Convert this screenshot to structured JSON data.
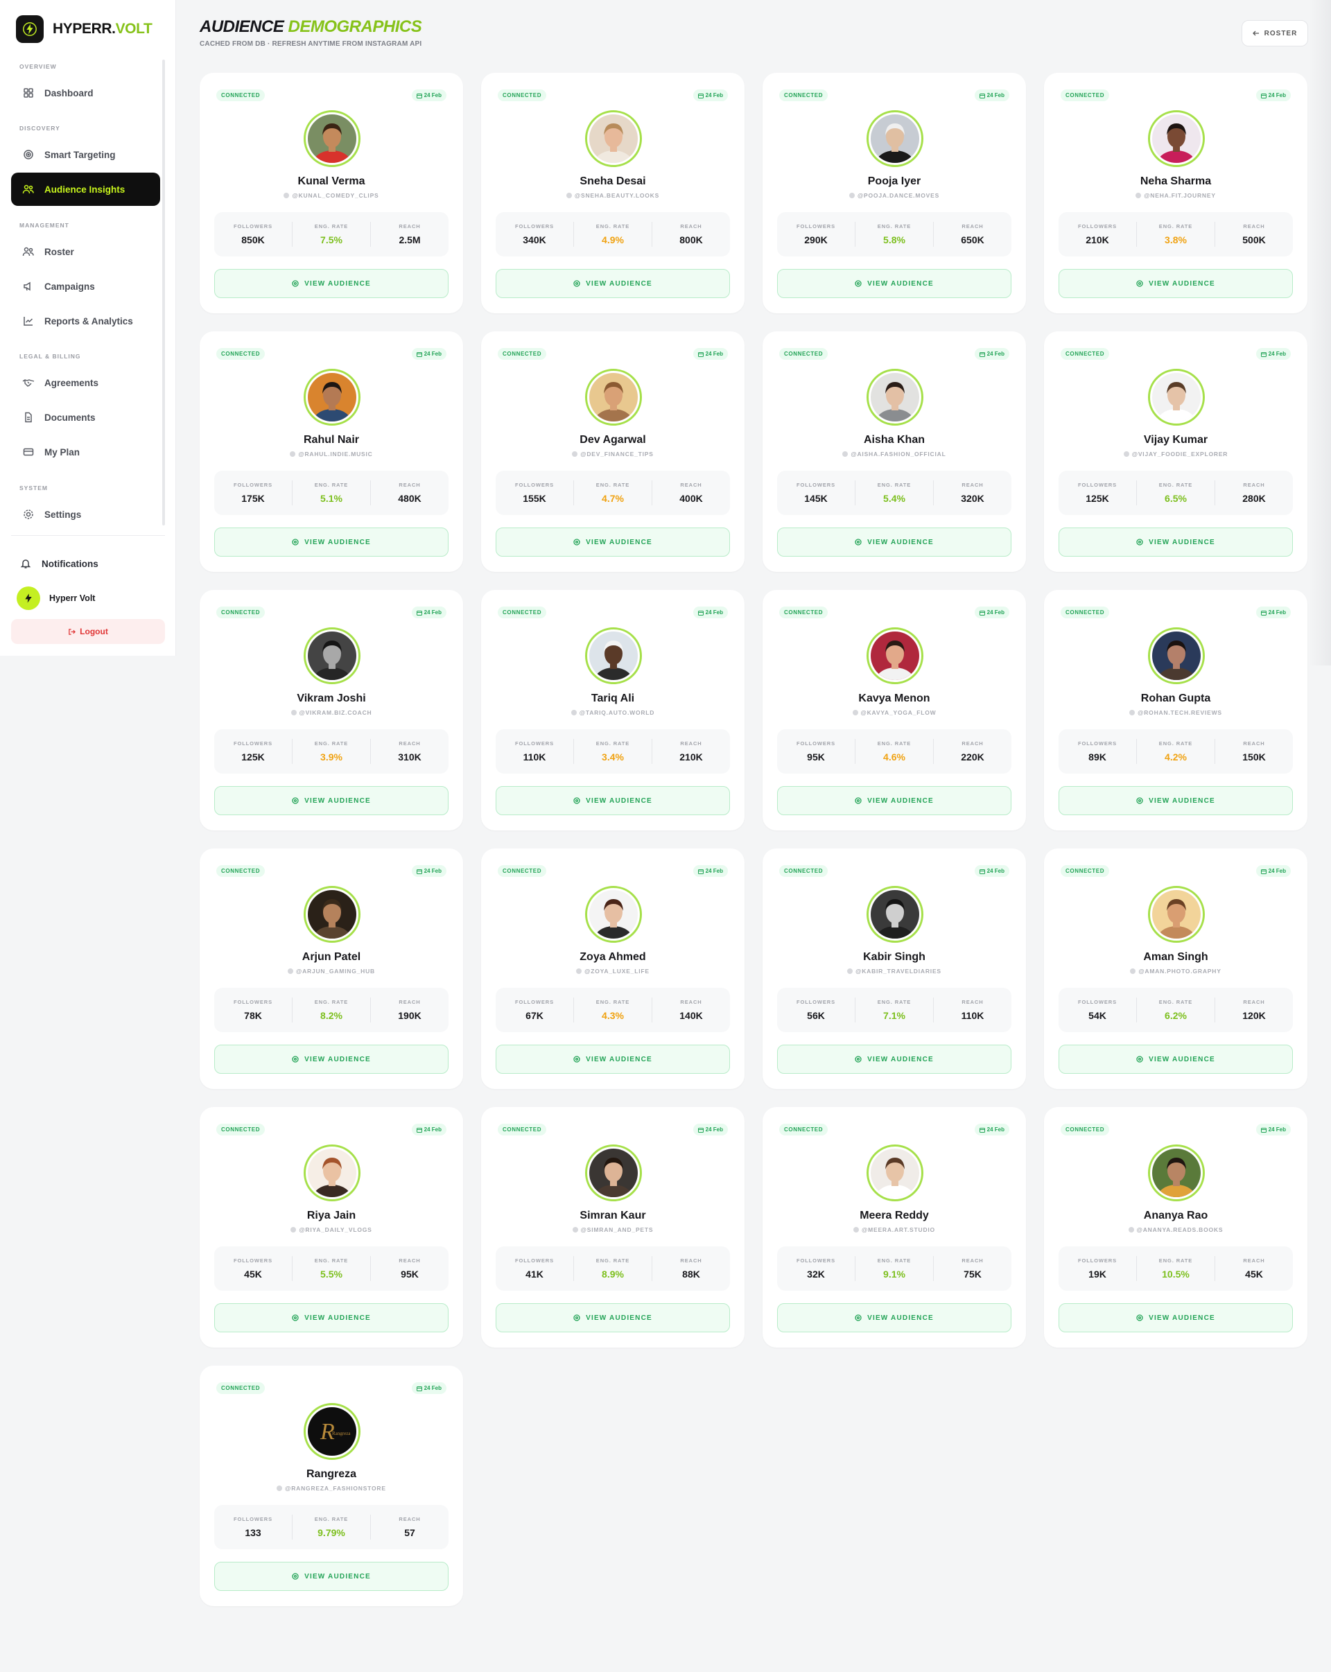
{
  "brand": {
    "name_part1": "HYPERR.",
    "name_part2": "VOLT"
  },
  "sidebar": {
    "sections": {
      "overview": "OVERVIEW",
      "discovery": "DISCOVERY",
      "management": "MANAGEMENT",
      "legal": "LEGAL & BILLING",
      "system": "SYSTEM"
    },
    "items": [
      {
        "label": "Dashboard",
        "icon": "grid-icon"
      },
      {
        "label": "Smart Targeting",
        "icon": "target-icon"
      },
      {
        "label": "Audience Insights",
        "icon": "users-icon",
        "active": true
      },
      {
        "label": "Roster",
        "icon": "user-group-icon"
      },
      {
        "label": "Campaigns",
        "icon": "megaphone-icon"
      },
      {
        "label": "Reports & Analytics",
        "icon": "chart-icon"
      },
      {
        "label": "Agreements",
        "icon": "handshake-icon"
      },
      {
        "label": "Documents",
        "icon": "document-icon"
      },
      {
        "label": "My Plan",
        "icon": "card-icon"
      },
      {
        "label": "Settings",
        "icon": "gear-icon"
      }
    ],
    "notifications": "Notifications",
    "user_name": "Hyperr Volt",
    "logout": "Logout"
  },
  "page": {
    "title_part1": "AUDIENCE",
    "title_part2": "DEMOGRAPHICS",
    "subtitle": "CACHED FROM DB · REFRESH ANYTIME FROM INSTAGRAM API",
    "roster_button": "ROSTER"
  },
  "labels": {
    "connected": "CONNECTED",
    "followers": "FOLLOWERS",
    "eng_rate": "ENG. RATE",
    "reach": "REACH",
    "view_audience": "VIEW AUDIENCE"
  },
  "colors": {
    "accent": "#86c21a",
    "connected_green": "#22a356",
    "eng_orange": "#f0a211",
    "eng_green": "#7cbf1d"
  },
  "influencers": [
    {
      "name": "Kunal Verma",
      "handle": "@KUNAL_COMEDY_CLIPS",
      "date": "24 Feb",
      "followers": "850K",
      "eng_rate": "7.5%",
      "eng_tone": "green",
      "reach": "2.5M",
      "av_bg": "#7a8e63",
      "av_skin": "#c48a5c",
      "av_hair": "#3a2413",
      "av_shirt": "#d8322c"
    },
    {
      "name": "Sneha Desai",
      "handle": "@SNEHA.BEAUTY.LOOKS",
      "date": "24 Feb",
      "followers": "340K",
      "eng_rate": "4.9%",
      "eng_tone": "orange",
      "reach": "800K",
      "av_bg": "#e6d8c8",
      "av_skin": "#e7b99a",
      "av_hair": "#b78b5a",
      "av_shirt": "#f0e9df"
    },
    {
      "name": "Pooja Iyer",
      "handle": "@POOJA.DANCE.MOVES",
      "date": "24 Feb",
      "followers": "290K",
      "eng_rate": "5.8%",
      "eng_tone": "green",
      "reach": "650K",
      "av_bg": "#c7ccd3",
      "av_skin": "#e0bfa2",
      "av_hair": "#efefef",
      "av_shirt": "#1a1a1a"
    },
    {
      "name": "Neha Sharma",
      "handle": "@NEHA.FIT.JOURNEY",
      "date": "24 Feb",
      "followers": "210K",
      "eng_rate": "3.8%",
      "eng_tone": "orange",
      "reach": "500K",
      "av_bg": "#efe7ee",
      "av_skin": "#7a4a34",
      "av_hair": "#1e1412",
      "av_shirt": "#c81e5a"
    },
    {
      "name": "Rahul Nair",
      "handle": "@RAHUL.INDIE.MUSIC",
      "date": "24 Feb",
      "followers": "175K",
      "eng_rate": "5.1%",
      "eng_tone": "green",
      "reach": "480K",
      "av_bg": "#d9842e",
      "av_skin": "#b47a54",
      "av_hair": "#1d1613",
      "av_shirt": "#2d4a72"
    },
    {
      "name": "Dev Agarwal",
      "handle": "@DEV_FINANCE_TIPS",
      "date": "24 Feb",
      "followers": "155K",
      "eng_rate": "4.7%",
      "eng_tone": "orange",
      "reach": "400K",
      "av_bg": "#e8c88f",
      "av_skin": "#d9a176",
      "av_hair": "#8b5a32",
      "av_shirt": "#a4744c"
    },
    {
      "name": "Aisha Khan",
      "handle": "@AISHA.FASHION_OFFICIAL",
      "date": "24 Feb",
      "followers": "145K",
      "eng_rate": "5.4%",
      "eng_tone": "green",
      "reach": "320K",
      "av_bg": "#e2e2e0",
      "av_skin": "#e3c0a5",
      "av_hair": "#2a1d17",
      "av_shirt": "#8a8d90"
    },
    {
      "name": "Vijay Kumar",
      "handle": "@VIJAY_FOODIE_EXPLORER",
      "date": "24 Feb",
      "followers": "125K",
      "eng_rate": "6.5%",
      "eng_tone": "green",
      "reach": "280K",
      "av_bg": "#f2f2f2",
      "av_skin": "#e5c3a8",
      "av_hair": "#5a3d28",
      "av_shirt": "#ffffff"
    },
    {
      "name": "Vikram Joshi",
      "handle": "@VIKRAM.BIZ.COACH",
      "date": "24 Feb",
      "followers": "125K",
      "eng_rate": "3.9%",
      "eng_tone": "orange",
      "reach": "310K",
      "av_bg": "#444",
      "av_skin": "#a8a8a8",
      "av_hair": "#151515",
      "av_shirt": "#262626"
    },
    {
      "name": "Tariq Ali",
      "handle": "@TARIQ.AUTO.WORLD",
      "date": "24 Feb",
      "followers": "110K",
      "eng_rate": "3.4%",
      "eng_tone": "orange",
      "reach": "210K",
      "av_bg": "#dde4ea",
      "av_skin": "#5a3a28",
      "av_hair": "#f4f4f4",
      "av_shirt": "#2b2b2b"
    },
    {
      "name": "Kavya Menon",
      "handle": "@KAVYA_YOGA_FLOW",
      "date": "24 Feb",
      "followers": "95K",
      "eng_rate": "4.6%",
      "eng_tone": "orange",
      "reach": "220K",
      "av_bg": "#b0283d",
      "av_skin": "#e2a98a",
      "av_hair": "#2a1a14",
      "av_shirt": "#f2f2f2"
    },
    {
      "name": "Rohan Gupta",
      "handle": "@ROHAN.TECH.REVIEWS",
      "date": "24 Feb",
      "followers": "89K",
      "eng_rate": "4.2%",
      "eng_tone": "orange",
      "reach": "150K",
      "av_bg": "#2a3a5a",
      "av_skin": "#b4806a",
      "av_hair": "#1a1210",
      "av_shirt": "#4b3a30"
    },
    {
      "name": "Arjun Patel",
      "handle": "@ARJUN_GAMING_HUB",
      "date": "24 Feb",
      "followers": "78K",
      "eng_rate": "8.2%",
      "eng_tone": "green",
      "reach": "190K",
      "av_bg": "#2a2118",
      "av_skin": "#b5825c",
      "av_hair": "#3a2a1a",
      "av_shirt": "#5a4430"
    },
    {
      "name": "Zoya Ahmed",
      "handle": "@ZOYA_LUXE_LIFE",
      "date": "24 Feb",
      "followers": "67K",
      "eng_rate": "4.3%",
      "eng_tone": "orange",
      "reach": "140K",
      "av_bg": "#f4f4f4",
      "av_skin": "#e6bfa3",
      "av_hair": "#4a2518",
      "av_shirt": "#2a2a2a"
    },
    {
      "name": "Kabir Singh",
      "handle": "@KABIR_TRAVELDIARIES",
      "date": "24 Feb",
      "followers": "56K",
      "eng_rate": "7.1%",
      "eng_tone": "green",
      "reach": "110K",
      "av_bg": "#3a3a3a",
      "av_skin": "#cfcfcf",
      "av_hair": "#141414",
      "av_shirt": "#1f1f1f"
    },
    {
      "name": "Aman Singh",
      "handle": "@AMAN.PHOTO.GRAPHY",
      "date": "24 Feb",
      "followers": "54K",
      "eng_rate": "6.2%",
      "eng_tone": "green",
      "reach": "120K",
      "av_bg": "#f2d49a",
      "av_skin": "#d99e72",
      "av_hair": "#6a4124",
      "av_shirt": "#c38a5a"
    },
    {
      "name": "Riya Jain",
      "handle": "@RIYA_DAILY_VLOGS",
      "date": "24 Feb",
      "followers": "45K",
      "eng_rate": "5.5%",
      "eng_tone": "green",
      "reach": "95K",
      "av_bg": "#f6eee6",
      "av_skin": "#eac2a3",
      "av_hair": "#a4532b",
      "av_shirt": "#3a2a22"
    },
    {
      "name": "Simran Kaur",
      "handle": "@SIMRAN_AND_PETS",
      "date": "24 Feb",
      "followers": "41K",
      "eng_rate": "8.9%",
      "eng_tone": "green",
      "reach": "88K",
      "av_bg": "#3a3633",
      "av_skin": "#ddb496",
      "av_hair": "#23170f",
      "av_shirt": "#4a3a30"
    },
    {
      "name": "Meera Reddy",
      "handle": "@MEERA.ART.STUDIO",
      "date": "24 Feb",
      "followers": "32K",
      "eng_rate": "9.1%",
      "eng_tone": "green",
      "reach": "75K",
      "av_bg": "#f0ece8",
      "av_skin": "#e7c4a7",
      "av_hair": "#5a3a26",
      "av_shirt": "#ffffff"
    },
    {
      "name": "Ananya Rao",
      "handle": "@ANANYA.READS.BOOKS",
      "date": "24 Feb",
      "followers": "19K",
      "eng_rate": "10.5%",
      "eng_tone": "green",
      "reach": "45K",
      "av_bg": "#5a7a3a",
      "av_skin": "#b88564",
      "av_hair": "#1f1611",
      "av_shirt": "#e0a23a"
    },
    {
      "name": "Rangreza",
      "handle": "@RANGREZA_FASHIONSTORE",
      "date": "24 Feb",
      "followers": "133",
      "eng_rate": "9.79%",
      "eng_tone": "green",
      "reach": "57",
      "av_logo": "Rangreza",
      "av_bg": "#0e0e0e"
    }
  ]
}
